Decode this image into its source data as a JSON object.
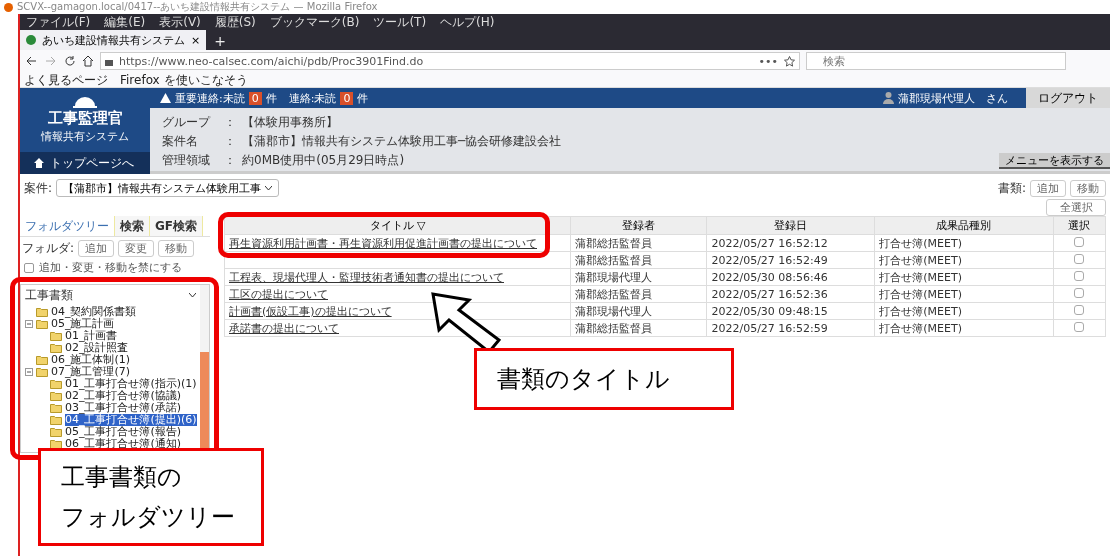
{
  "window": {
    "title": "SCVX--gamagon.local/0417--あいち建設情報共有システム — Mozilla Firefox"
  },
  "menu": [
    "ファイル(F)",
    "編集(E)",
    "表示(V)",
    "履歴(S)",
    "ブックマーク(B)",
    "ツール(T)",
    "ヘルプ(H)"
  ],
  "browser_tab": {
    "label": "あいち建設情報共有システム",
    "close": "×",
    "new": "+"
  },
  "address_bar": {
    "url": "https://www.neo-calsec.com/aichi/pdb/Proc3901Find.do",
    "more": "•••"
  },
  "search": {
    "placeholder": "検索"
  },
  "bookmarks": [
    "よく見るページ",
    "Firefox を使いこなそう"
  ],
  "app": {
    "logo_title": "工事監理官",
    "logo_subtitle": "情報共有システム",
    "home": "トップページへ",
    "notice": [
      {
        "label": "重要連絡:未読",
        "count": "0",
        "unit": "件"
      },
      {
        "label": "連絡:未読",
        "count": "0",
        "unit": "件"
      }
    ],
    "user": "蒲郡現場代理人　さん",
    "logout": "ログアウト",
    "info": [
      {
        "label": "グループ",
        "separator": "：",
        "value": "【体験用事務所】"
      },
      {
        "label": "案件名",
        "separator": "：",
        "value": "【蒲郡市】情報共有システム体験用工事─協会研修建設会社"
      },
      {
        "label": "管理領域",
        "separator": "：",
        "value": "約0MB使用中(05月29日時点)"
      }
    ],
    "show_menu": "メニューを表示する"
  },
  "project": {
    "label": "案件:",
    "value": "【蒲郡市】情報共有システム体験用工事"
  },
  "doc_actions": {
    "label": "書類:",
    "buttons": [
      "追加",
      "移動"
    ],
    "select_all": "全選択"
  },
  "side": {
    "tabs": [
      {
        "label": "フォルダツリー",
        "selected": true
      },
      {
        "label": "検索",
        "selected": false
      },
      {
        "label": "GF検索",
        "selected": false
      }
    ],
    "folder_label": "フォルダ:",
    "folder_buttons": [
      "追加",
      "変更",
      "移動"
    ],
    "lock": {
      "label": "追加・変更・移動を禁にする",
      "checked": false
    },
    "tree_root": "工事書類",
    "tree": [
      {
        "label": "04_契約関係書類",
        "selected": false
      },
      {
        "label": "05_施工計画",
        "selected": false,
        "expanded": true,
        "children": [
          {
            "label": "01_計画書",
            "selected": false
          },
          {
            "label": "02_設計照査",
            "selected": false
          }
        ]
      },
      {
        "label": "06_施工体制(1)",
        "selected": false
      },
      {
        "label": "07_施工管理(7)",
        "selected": false,
        "expanded": true,
        "children": [
          {
            "label": "01_工事打合せ簿(指示)(1)",
            "selected": false
          },
          {
            "label": "02_工事打合せ簿(協議)",
            "selected": false
          },
          {
            "label": "03_工事打合せ簿(承諾)",
            "selected": false
          },
          {
            "label": "04_工事打合せ簿(提出)(6)",
            "selected": true
          },
          {
            "label": "05_工事打合せ簿(報告)",
            "selected": false
          },
          {
            "label": "06_工事打合せ簿(通知)",
            "selected": false
          }
        ]
      }
    ]
  },
  "table": {
    "columns": [
      "タイトル ▽",
      "登録者",
      "登録日",
      "成果品種別",
      "選択"
    ],
    "rows": [
      {
        "title": "再生資源利用計画書・再生資源利用促進計画書の提出について",
        "user": "蒲郡総括監督員",
        "date": "2022/05/27 16:52:12",
        "type": "打合せ簿(MEET)",
        "selected": false
      },
      {
        "user": "蒲郡総括監督員",
        "date": "2022/05/27 16:52:49",
        "type": "打合せ簿(MEET)",
        "selected": false
      },
      {
        "title": "工程表、現場代理人・監理技術者通知書の提出について",
        "user": "蒲郡現場代理人",
        "date": "2022/05/30 08:56:46",
        "type": "打合せ簿(MEET)",
        "selected": false
      },
      {
        "title": "工区の提出について",
        "user": "蒲郡総括監督員",
        "date": "2022/05/27 16:52:36",
        "type": "打合せ簿(MEET)",
        "selected": false
      },
      {
        "title": "計画書(仮設工事)の提出について",
        "user": "蒲郡現場代理人",
        "date": "2022/05/30 09:48:15",
        "type": "打合せ簿(MEET)",
        "selected": false
      },
      {
        "title": "承諾書の提出について",
        "user": "蒲郡総括監督員",
        "date": "2022/05/27 16:52:59",
        "type": "打合せ簿(MEET)",
        "selected": false
      }
    ]
  },
  "callouts": [
    {
      "lines": [
        "書類のタイトル"
      ]
    },
    {
      "lines": [
        "工事書類の",
        "フォルダツリー"
      ]
    }
  ]
}
